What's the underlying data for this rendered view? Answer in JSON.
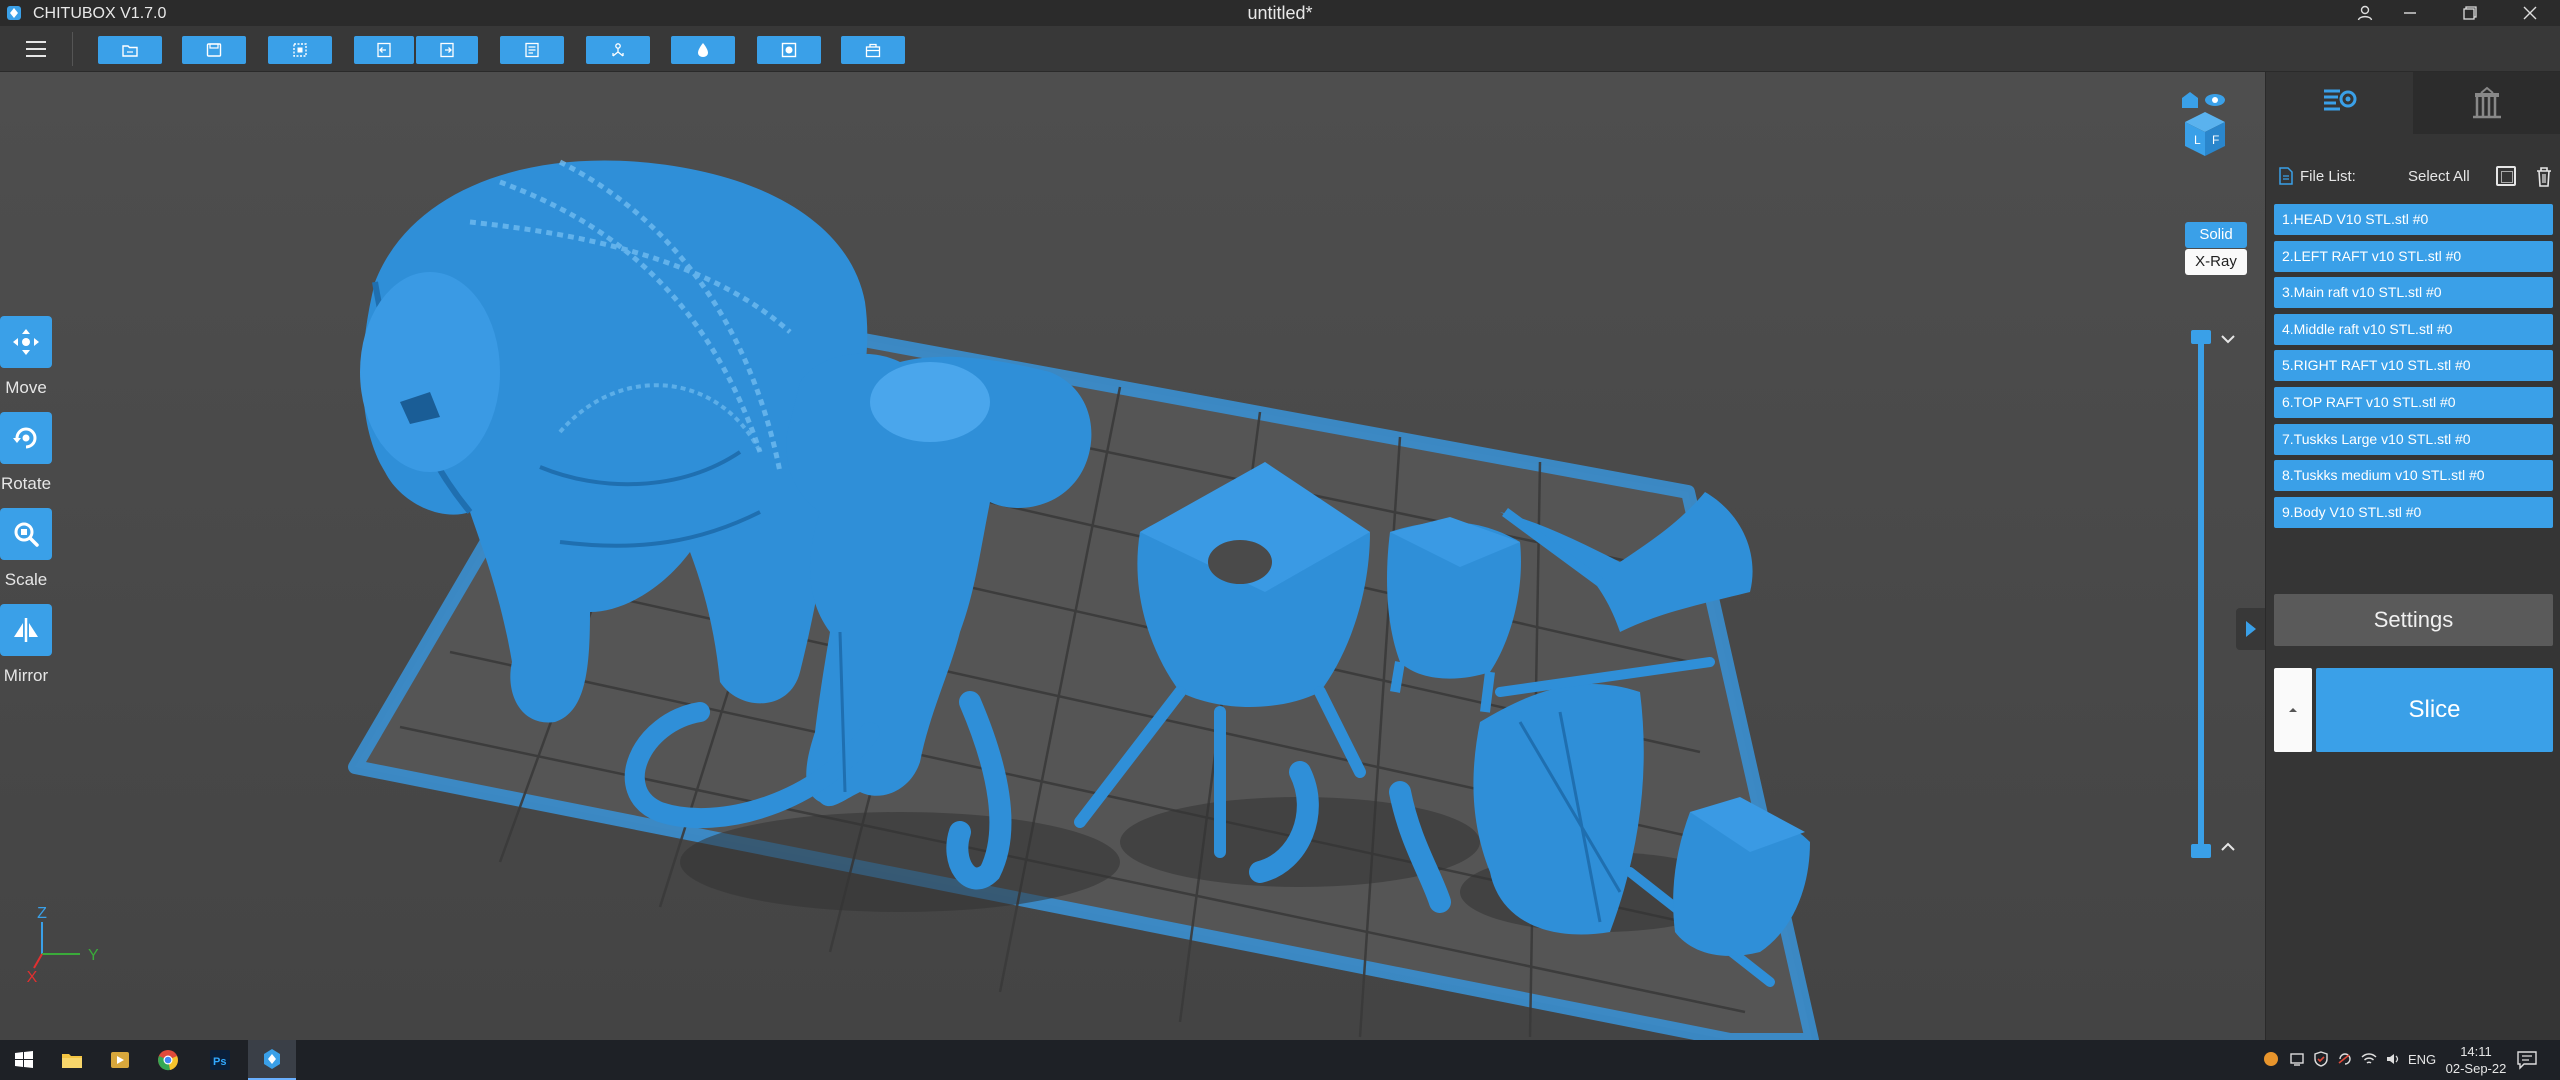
{
  "window": {
    "app_name": "CHITUBOX V1.7.0",
    "doc_title": "untitled*"
  },
  "toolbar": {
    "buttons": [
      "open-file-icon",
      "save-icon",
      "select-icon",
      "import-icon",
      "export-icon",
      "layout-icon",
      "support-icon",
      "hollow-icon",
      "dig-hole-icon",
      "package-icon"
    ]
  },
  "left_tools": [
    {
      "label": "Move",
      "icon": "move-icon"
    },
    {
      "label": "Rotate",
      "icon": "rotate-icon"
    },
    {
      "label": "Scale",
      "icon": "scale-icon"
    },
    {
      "label": "Mirror",
      "icon": "mirror-icon"
    }
  ],
  "view_modes": {
    "solid": "Solid",
    "xray": "X-Ray",
    "active": "Solid"
  },
  "axes": {
    "x": "X",
    "y": "Y",
    "z": "Z"
  },
  "file_list": {
    "label": "File List:",
    "select_all": "Select All",
    "items": [
      "1.HEAD V10 STL.stl #0",
      "2.LEFT RAFT v10 STL.stl #0",
      "3.Main raft v10 STL.stl #0",
      "4.Middle raft v10 STL.stl #0",
      "5.RIGHT RAFT v10 STL.stl #0",
      "6.TOP RAFT v10 STL.stl #0",
      "7.Tuskks Large v10 STL.stl #0",
      "8.Tuskks medium v10 STL.stl #0",
      "9.Body V10 STL.stl #0"
    ]
  },
  "buttons": {
    "settings": "Settings",
    "slice": "Slice"
  },
  "taskbar": {
    "apps": [
      "windows-start-icon",
      "file-explorer-icon",
      "media-player-icon",
      "chrome-icon",
      "photoshop-icon",
      "chitubox-icon"
    ],
    "active_app": "chitubox-icon",
    "lang": "ENG",
    "time": "14:11",
    "date": "02-Sep-22"
  },
  "colors": {
    "accent": "#3aa0e8",
    "model": "#2f8fd8",
    "background": "#4b4b4b",
    "panel": "#353535"
  }
}
